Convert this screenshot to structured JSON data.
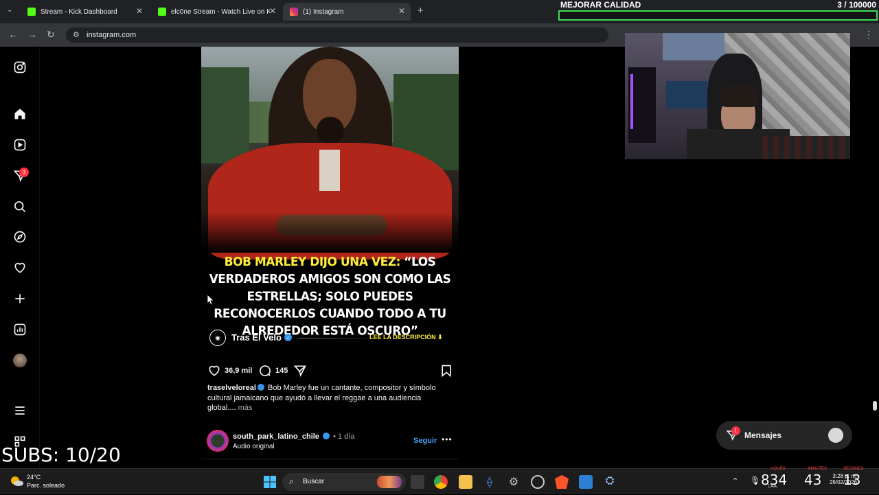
{
  "browser": {
    "tabs": [
      {
        "title": "Stream - Kick Dashboard",
        "fav_color": "#53fc18"
      },
      {
        "title": "elc0ne Stream - Watch Live on Kick",
        "fav_color": "#53fc18"
      },
      {
        "title": "(1) Instagram",
        "fav_color": "#e1306c"
      }
    ],
    "url": "instagram.com"
  },
  "quality_overlay": {
    "label": "MEJORAR CALIDAD",
    "count": "3 / 100000",
    "progress": 3e-05
  },
  "sidebar": {
    "items": [
      {
        "name": "instagram-logo-icon"
      },
      {
        "name": "home-icon"
      },
      {
        "name": "reels-icon"
      },
      {
        "name": "messages-icon",
        "badge": "3"
      },
      {
        "name": "search-icon"
      },
      {
        "name": "explore-icon"
      },
      {
        "name": "notifications-icon"
      },
      {
        "name": "create-icon"
      },
      {
        "name": "dashboard-icon"
      },
      {
        "name": "profile-avatar"
      },
      {
        "name": "menu-icon"
      },
      {
        "name": "also-from-meta-icon"
      }
    ]
  },
  "post": {
    "quote_highlight": "BOB MARLEY DIJO UNA VEZ:",
    "quote_rest": " “LOS VERDADEROS AMIGOS SON COMO LAS ESTRELLAS; SOLO PUEDES RECONOCERLOS CUANDO TODO A TU ALREDEDOR ESTÁ OSCURO”",
    "brand_name": "Tras El Velo",
    "brand_cta": "LEE LA DESCRIPCIÓN ⬇",
    "likes": "36,9 mil",
    "comments": "145",
    "caption_user": "traselveloreal",
    "caption_text": " Bob Marley fue un cantante, compositor y símbolo cultural jamaicano que ayudó a llevar el reggae a una audiencia global.... ",
    "caption_more": "más"
  },
  "next_post": {
    "user": "south_park_latino_chile",
    "time": "• 1 día",
    "audio": "Audio original",
    "follow": "Seguir",
    "more": "•••"
  },
  "messages_widget": {
    "label": "Mensajes",
    "badge": "1"
  },
  "stream_overlay": {
    "subs": "SUBS: 10/20",
    "num_a": "834",
    "num_b": "43",
    "num_c": "13",
    "hours": "HOURS",
    "minutes": "MINUTES",
    "seconds": "SECONDS"
  },
  "taskbar": {
    "temp": "24°C",
    "condition": "Parc. soleado",
    "search": "Buscar",
    "time": "3:28 p. m.",
    "date": "26/02/2026",
    "lang": "LAA"
  }
}
